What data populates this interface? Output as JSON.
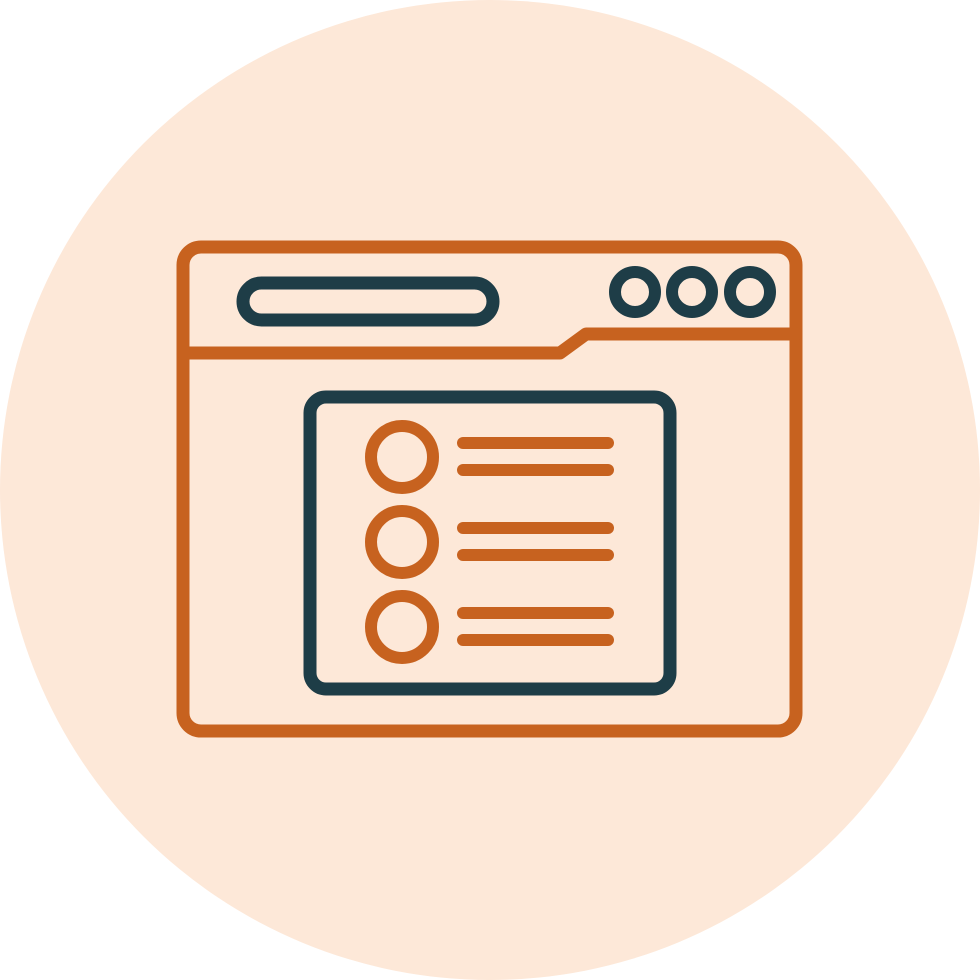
{
  "icon": {
    "name": "browser-list-icon",
    "colors": {
      "background_circle": "#fde8d8",
      "accent": "#c7621f",
      "outline_dark": "#1e3d47"
    },
    "list_items": 3,
    "window_dots": 3
  }
}
